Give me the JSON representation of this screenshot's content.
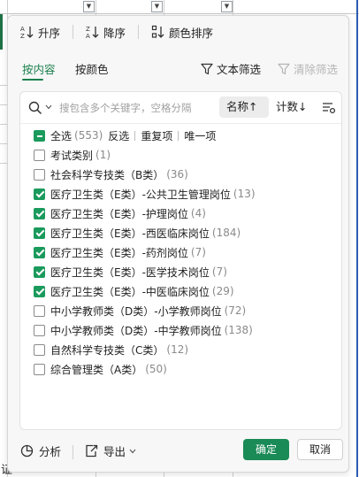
{
  "sheet": {
    "partial_text": "证"
  },
  "sortbar": {
    "asc_label": "升序",
    "desc_label": "降序",
    "color_sort_label": "颜色排序"
  },
  "tabs": {
    "by_content": "按内容",
    "by_color": "按颜色",
    "text_filter": "文本筛选",
    "clear_filter": "清除筛选"
  },
  "search": {
    "placeholder": "搜包含多个关键字，空格分隔",
    "value": "",
    "sort_name_label": "名称↑",
    "sort_count_label": "计数↓"
  },
  "select_all": {
    "label": "全选",
    "count": "(553)",
    "state": "partial",
    "actions": [
      "反选",
      "重复项",
      "唯一项"
    ]
  },
  "items": [
    {
      "label": "考试类别",
      "count": "(1)",
      "checked": false
    },
    {
      "label": "社会科学专技类（B类）",
      "count": "(36)",
      "checked": false
    },
    {
      "label": "医疗卫生类（E类）-公共卫生管理岗位",
      "count": "(13)",
      "checked": true
    },
    {
      "label": "医疗卫生类（E类）-护理岗位",
      "count": "(4)",
      "checked": true
    },
    {
      "label": "医疗卫生类（E类）-西医临床岗位",
      "count": "(184)",
      "checked": true
    },
    {
      "label": "医疗卫生类（E类）-药剂岗位",
      "count": "(7)",
      "checked": true
    },
    {
      "label": "医疗卫生类（E类）-医学技术岗位",
      "count": "(7)",
      "checked": true
    },
    {
      "label": "医疗卫生类（E类）-中医临床岗位",
      "count": "(29)",
      "checked": true
    },
    {
      "label": "中小学教师类（D类）-小学教师岗位",
      "count": "(72)",
      "checked": false
    },
    {
      "label": "中小学教师类（D类）-中学教师岗位",
      "count": "(138)",
      "checked": false
    },
    {
      "label": "自然科学专技类（C类）",
      "count": "(12)",
      "checked": false
    },
    {
      "label": "综合管理类（A类）",
      "count": "(50)",
      "checked": false
    }
  ],
  "footer": {
    "analyze_label": "分析",
    "export_label": "导出",
    "ok_label": "确定",
    "cancel_label": "取消"
  },
  "colors": {
    "accent": "#1a7f4b",
    "checkbox": "#1a9a5c",
    "ok_button": "#1a8a57"
  }
}
